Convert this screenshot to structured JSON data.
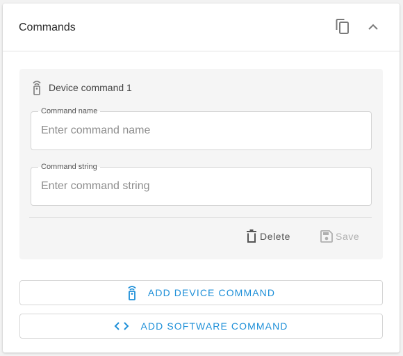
{
  "header": {
    "title": "Commands",
    "copy_icon": "copy-icon",
    "collapse_icon": "chevron-up-icon"
  },
  "command": {
    "icon": "remote-control-icon",
    "title": "Device command 1",
    "name_field": {
      "label": "Command name",
      "value": "",
      "placeholder": "Enter command name"
    },
    "string_field": {
      "label": "Command string",
      "value": "",
      "placeholder": "Enter command string"
    },
    "delete_label": "Delete",
    "save_label": "Save"
  },
  "actions": {
    "add_device_label": "ADD DEVICE COMMAND",
    "add_device_icon": "remote-control-icon",
    "add_software_label": "ADD SOFTWARE COMMAND",
    "add_software_icon": "code-icon"
  },
  "colors": {
    "accent": "#1d8fd8",
    "disabled": "#b0b0b0",
    "panel": "#f5f5f5"
  }
}
